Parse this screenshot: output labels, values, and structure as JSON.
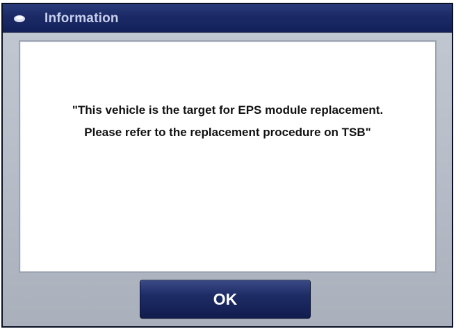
{
  "dialog": {
    "title": "Information",
    "icon": "info-dot-icon",
    "message_line_1": "\"This vehicle is the target for EPS module replacement.",
    "message_line_2": "Please refer to the replacement procedure on TSB\"",
    "ok_label": "OK"
  },
  "colors": {
    "title_bar": "#1b2a66",
    "title_text": "#c8d0ec",
    "dialog_background": "#b6bcc7",
    "button": "#1e2c66"
  }
}
